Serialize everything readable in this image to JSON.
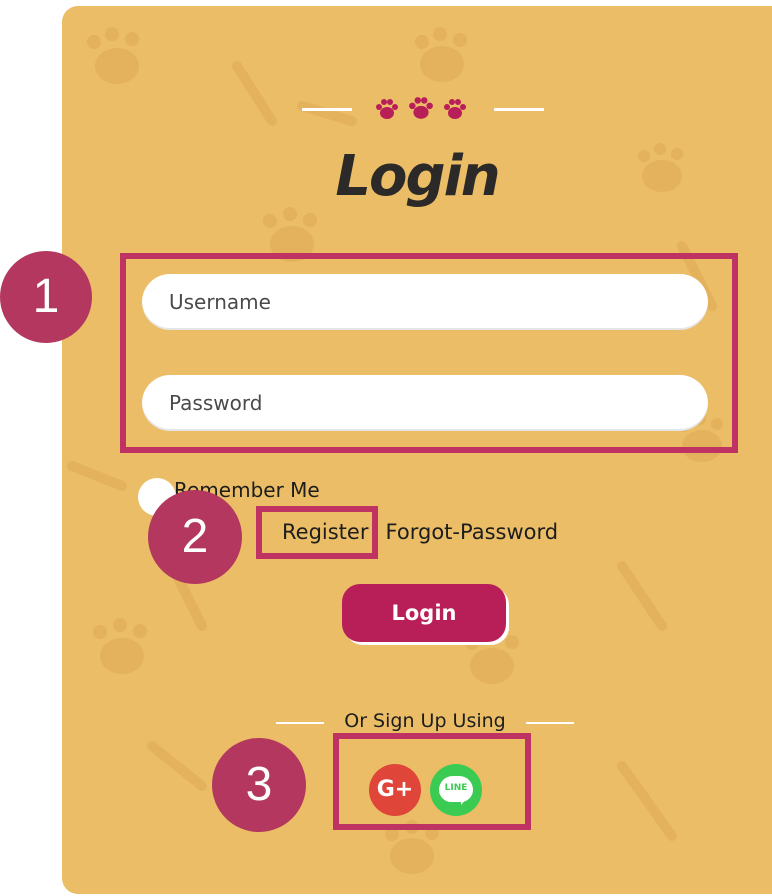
{
  "header": {
    "title": "Login",
    "ornament": "paw-prints-icon"
  },
  "form": {
    "username_placeholder": "Username",
    "password_placeholder": "Password",
    "remember_label": "Remember Me",
    "register_link": "Register",
    "separator": "|",
    "forgot_link": "Forgot-Password",
    "login_button": "Login"
  },
  "social": {
    "divider_text": "Or Sign Up Using",
    "google_label": "G+",
    "line_label": "LINE"
  },
  "annotations": {
    "badge_1": "1",
    "badge_2": "2",
    "badge_3": "3"
  },
  "colors": {
    "card_background": "#ebbd66",
    "accent": "#b81e58",
    "annotation": "#be3362"
  }
}
